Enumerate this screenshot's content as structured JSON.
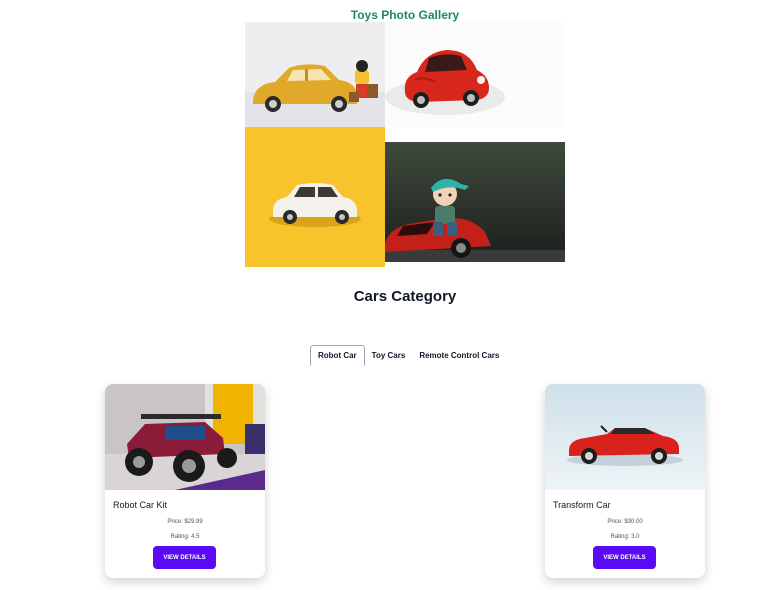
{
  "gallery": {
    "title": "Toys Photo Gallery",
    "images": [
      {
        "subject": "yellow-toy-car-with-figure"
      },
      {
        "subject": "red-beetle-toy-car"
      },
      {
        "subject": "white-toy-car-on-yellow"
      },
      {
        "subject": "figure-on-red-sports-car"
      }
    ]
  },
  "category": {
    "title": "Cars Category",
    "tabs": [
      {
        "label": "Robot Car",
        "active": true
      },
      {
        "label": "Toy Cars",
        "active": false
      },
      {
        "label": "Remote Control Cars",
        "active": false
      }
    ]
  },
  "cards": [
    {
      "title": "Robot Car Kit",
      "price": "Price: $29.99",
      "rating": "Rating: 4.5",
      "button": "VIEW DETAILS"
    },
    {
      "title": "Transform Car",
      "price": "Price: $30.00",
      "rating": "Rating: 3.0",
      "button": "VIEW DETAILS"
    }
  ],
  "colors": {
    "title_accent": "#1f8a5b",
    "button": "#5b0af5"
  }
}
